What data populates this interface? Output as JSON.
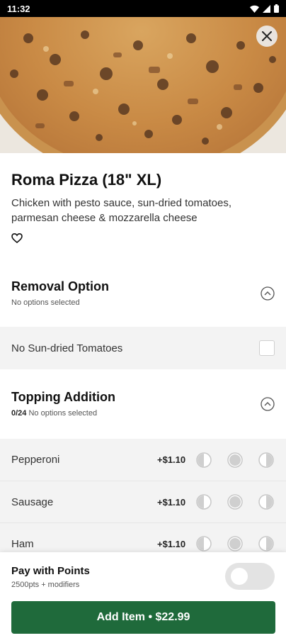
{
  "status_bar": {
    "time": "11:32"
  },
  "item": {
    "title": "Roma Pizza (18\" XL)",
    "description": "Chicken with pesto sauce, sun-dried tomatoes, parmesan cheese & mozzarella cheese"
  },
  "removal": {
    "title": "Removal Option",
    "subtitle": "No options selected",
    "options": [
      {
        "label": "No Sun-dried Tomatoes",
        "checked": false
      }
    ]
  },
  "topping": {
    "title": "Topping Addition",
    "count": "0/24",
    "subtitle": "No options selected",
    "items": [
      {
        "name": "Pepperoni",
        "price": "+$1.10"
      },
      {
        "name": "Sausage",
        "price": "+$1.10"
      },
      {
        "name": "Ham",
        "price": "+$1.10"
      }
    ]
  },
  "points": {
    "title": "Pay with Points",
    "subtitle": "2500pts + modifiers",
    "enabled": false
  },
  "cta": {
    "label": "Add Item • $22.99"
  },
  "colors": {
    "accent": "#1f6a3b",
    "section_bg": "#f3f3f3"
  }
}
